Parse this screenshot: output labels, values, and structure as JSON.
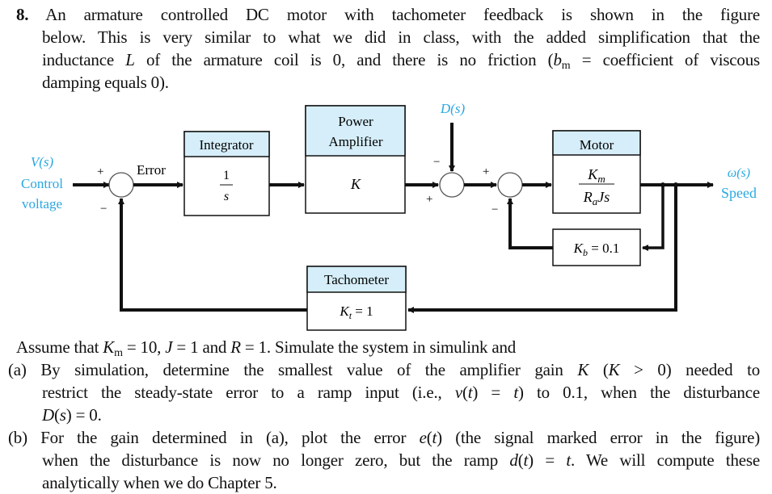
{
  "problem": {
    "number": "8.",
    "intro_lines": [
      "An armature controlled DC motor with tachometer feedback is shown in the figure",
      "below. This is very similar to what we did in class, with the added simplification that the",
      "inductance ",
      "L",
      " of the armature coil is 0, and there is no friction (",
      "b",
      "m",
      " = coefficient of viscous",
      "damping equals 0)."
    ]
  },
  "diagram": {
    "input_label_symbol": "V(s)",
    "input_label_line2": "Control",
    "input_label_line3": "voltage",
    "output_label_symbol": "ω(s)",
    "output_label_line2": "Speed",
    "disturbance_label": "D(s)",
    "error_label": "Error",
    "label_color": "#29a8e0",
    "header_fill": "#d5eef9",
    "blocks": {
      "integrator": {
        "title": "Integrator",
        "num": "1",
        "den": "s"
      },
      "amplifier": {
        "title_line1": "Power",
        "title_line2": "Amplifier",
        "gain": "K"
      },
      "motor": {
        "title": "Motor",
        "num_main": "K",
        "num_sub": "m",
        "den_R": "R",
        "den_sub": "a",
        "den_rest": "Js"
      },
      "back_emf": {
        "sym": "K",
        "sub": "b",
        "eq": " = 0.1"
      },
      "tachometer": {
        "title": "Tachometer",
        "sym": "K",
        "sub": "t",
        "eq": " = 1"
      }
    },
    "signs": {
      "sum1_plus": "+",
      "sum1_minus": "−",
      "sum2_minus": "−",
      "sum2_plus": "+",
      "sum3_plus": "+",
      "sum3_minus": "−"
    }
  },
  "assumptions": {
    "t1": "Assume that ",
    "k": "K",
    "k_sub": "m",
    "t2": " = 10, ",
    "j": "J",
    "t3": " = 1 and ",
    "r": "R",
    "t4": " = 1. Simulate the system in simulink and"
  },
  "part_a": {
    "l1a": "(a) By simulation, determine the smallest value of the amplifier gain ",
    "k1": "K",
    "l1b": " (",
    "k2": "K",
    "l1c": " > 0) needed to",
    "l2a": "restrict the steady-state error to a ramp input (i.e., ",
    "v": "v",
    "l2b": "(",
    "t": "t",
    "l2c": ") = ",
    "t2": "t",
    "l2d": ") to 0.1, when the disturbance",
    "l3a": "D",
    "l3b": "(",
    "l3s": "s",
    "l3c": ") = 0."
  },
  "part_b": {
    "l1a": "(b) For the gain determined in (a), plot the error ",
    "e": "e",
    "l1b": "(",
    "t": "t",
    "l1c": ") (the signal marked error in the figure)",
    "l2a": "when the disturbance is now no longer zero, but the ramp ",
    "d": "d",
    "l2b": "(",
    "t2": "t",
    "l2c": ") = ",
    "t3": "t",
    "l2d": ". We will compute these",
    "l3": "analytically when we do Chapter 5."
  }
}
